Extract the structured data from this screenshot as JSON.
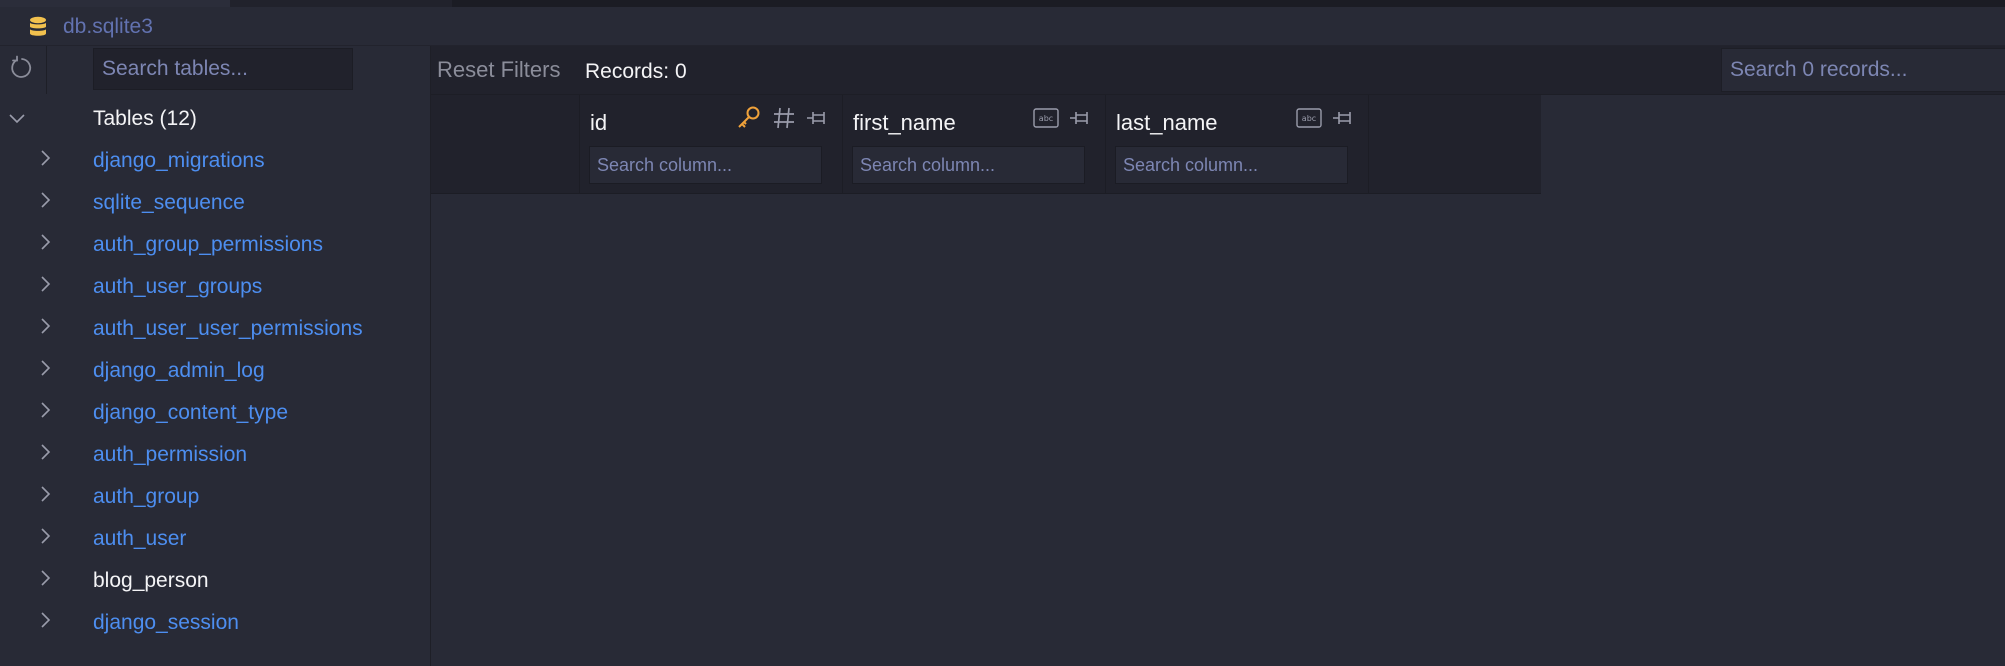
{
  "file": {
    "name": "db.sqlite3",
    "icon": "database-icon",
    "icon_color": "#f2c14e"
  },
  "sidebar": {
    "refresh_icon": "refresh-icon",
    "search_placeholder": "Search tables...",
    "tree_label": "Tables (12)",
    "tables": [
      {
        "name": "django_migrations"
      },
      {
        "name": "sqlite_sequence"
      },
      {
        "name": "auth_group_permissions"
      },
      {
        "name": "auth_user_groups"
      },
      {
        "name": "auth_user_user_permissions"
      },
      {
        "name": "django_admin_log"
      },
      {
        "name": "django_content_type"
      },
      {
        "name": "auth_permission"
      },
      {
        "name": "auth_group"
      },
      {
        "name": "auth_user"
      },
      {
        "name": "blog_person",
        "selected": true
      },
      {
        "name": "django_session"
      }
    ],
    "link_color": "#4d8ef0"
  },
  "toolbar": {
    "reset_label": "Reset Filters",
    "records_label": "Records:",
    "records_count": "0",
    "search_placeholder": "Search 0 records..."
  },
  "columns": [
    {
      "name": "id",
      "icons": [
        "key-icon",
        "number-type-icon",
        "pin-icon"
      ],
      "search_placeholder": "Search column..."
    },
    {
      "name": "first_name",
      "icons": [
        "text-type-icon",
        "pin-icon"
      ],
      "search_placeholder": "Search column..."
    },
    {
      "name": "last_name",
      "icons": [
        "text-type-icon",
        "pin-icon"
      ],
      "search_placeholder": "Search column..."
    }
  ],
  "colors": {
    "background": "#282a36",
    "key_icon": "#f0a23a"
  }
}
